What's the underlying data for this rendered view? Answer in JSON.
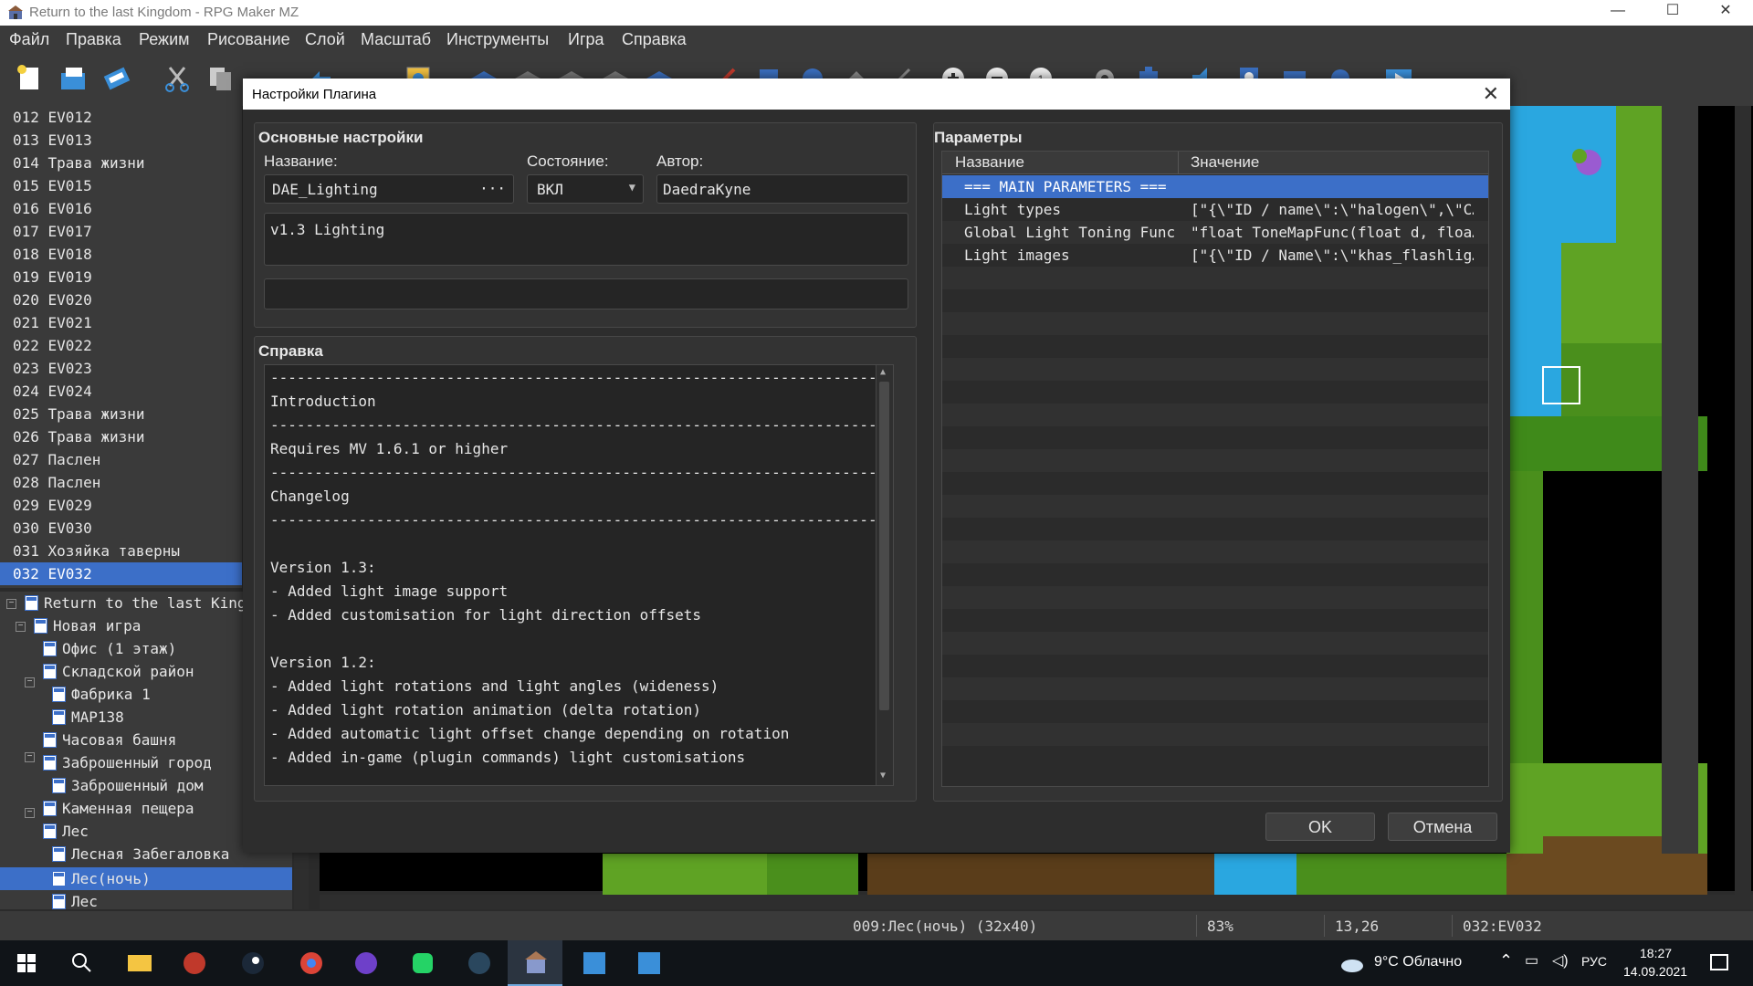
{
  "window": {
    "title": "Return to the last Kingdom - RPG Maker MZ",
    "minimize": "—",
    "maximize": "☐",
    "close": "✕"
  },
  "menu": [
    "Файл",
    "Правка",
    "Режим",
    "Рисование",
    "Слой",
    "Масштаб",
    "Инструменты",
    "Игра",
    "Справка"
  ],
  "events": [
    "012  EV012",
    "013  EV013",
    "014  Трава жизни",
    "015  EV015",
    "016  EV016",
    "017  EV017",
    "018  EV018",
    "019  EV019",
    "020  EV020",
    "021  EV021",
    "022  EV022",
    "023  EV023",
    "024  EV024",
    "025  Трава жизни",
    "026  Трава жизни",
    "027  Паслен",
    "028  Паслен",
    "029  EV029",
    "030  EV030",
    "031  Хозяйка таверны",
    "032  EV032"
  ],
  "map_tree": [
    "Return to the last Kingdom",
    "Новая игра",
    "Офис (1 этаж)",
    "Складской район",
    "Фабрика 1",
    "MAP138",
    "Часовая башня",
    "Заброшенный город",
    "Заброшенный дом",
    "Каменная пещера",
    "Лес",
    "Лесная Забегаловка",
    "Лес(ночь)",
    "Лес"
  ],
  "dialog": {
    "title": "Настройки Плагина",
    "close": "✕",
    "basic": {
      "title": "Основные настройки",
      "name_label": "Название:",
      "name_value": "DAE_Lighting",
      "name_btn": "···",
      "status_label": "Состояние:",
      "status_value": "ВКЛ",
      "author_label": "Автор:",
      "author_value": "DaedraKyne",
      "description": "v1.3 Lighting",
      "extra": ""
    },
    "help": {
      "title": "Справка",
      "lines": [
        "----------------------------------------------------------------------------",
        "Introduction",
        "----------------------------------------------------------------------------",
        "Requires MV 1.6.1 or higher",
        "----------------------------------------------------------------------------",
        "Changelog",
        "----------------------------------------------------------------------------",
        "",
        "Version 1.3:",
        "- Added light image support",
        "- Added customisation for light direction offsets",
        "",
        "Version 1.2:",
        "- Added light rotations and light angles (wideness)",
        "- Added light rotation animation (delta rotation)",
        "- Added automatic light offset change depending on rotation",
        "- Added in-game (plugin commands) light customisations"
      ]
    },
    "params": {
      "title": "Параметры",
      "col_name": "Название",
      "col_value": "Значение",
      "rows": [
        {
          "name": "=== MAIN PARAMETERS ===",
          "value": ""
        },
        {
          "name": "Light types",
          "value": "[\"{\\\"ID / name\\\":\\\"halogen\\\",\\\"C…"
        },
        {
          "name": "Global Light Toning Func…",
          "value": "\"float ToneMapFunc(float d, floa…"
        },
        {
          "name": "Light images",
          "value": "[\"{\\\"ID / Name\\\":\\\"khas_flashlig…"
        }
      ]
    },
    "ok": "OK",
    "cancel": "Отмена"
  },
  "status": {
    "map": "009:Лес(ночь) (32x40)",
    "zoom": "83%",
    "coords": "13,26",
    "event": "032:EV032"
  },
  "taskbar": {
    "weather": "9°C  Облачно",
    "lang": "РУС",
    "time": "18:27",
    "date": "14.09.2021"
  },
  "colors": {
    "accent": "#3c6fc8",
    "panel": "#3a3a3a",
    "dialog": "#2d2d2d",
    "grass": "#5fa324",
    "water": "#2aa7e0"
  }
}
